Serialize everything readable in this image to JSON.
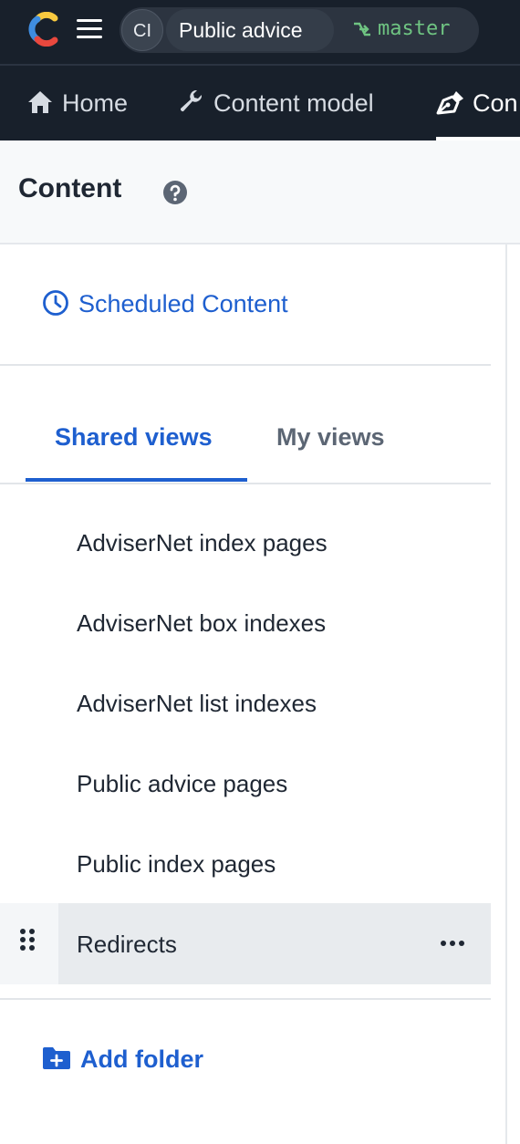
{
  "topbar": {
    "logo_icon": "contentful-logo-icon",
    "menu_icon": "hamburger-menu-icon",
    "space_initials": "CI",
    "space_name": "Public advice",
    "environment": "master",
    "environment_icon": "branch-icon",
    "environment_color": "#6fc482"
  },
  "nav": {
    "items": [
      {
        "label": "Home",
        "icon": "home-icon"
      },
      {
        "label": "Content model",
        "icon": "wrench-icon"
      },
      {
        "label": "Con",
        "icon": "pen-nib-icon",
        "active": true
      }
    ]
  },
  "header": {
    "title": "Content",
    "help_icon": "question-circle-icon"
  },
  "sidebar": {
    "scheduled_label": "Scheduled Content",
    "scheduled_icon": "clock-icon",
    "tabs": [
      {
        "label": "Shared views",
        "active": true
      },
      {
        "label": "My views",
        "active": false
      }
    ],
    "views": [
      "AdviserNet index pages",
      "AdviserNet box indexes",
      "AdviserNet list indexes",
      "Public advice pages",
      "Public index pages",
      "Redirects"
    ],
    "hovered_view_index": 5,
    "add_folder_label": "Add folder",
    "add_folder_icon": "folder-plus-icon"
  },
  "colors": {
    "topbar_bg": "#18202b",
    "accent_blue": "#1e5fcf",
    "header_bg": "#f7f9fa",
    "hover_row_bg": "#e8ebee"
  }
}
